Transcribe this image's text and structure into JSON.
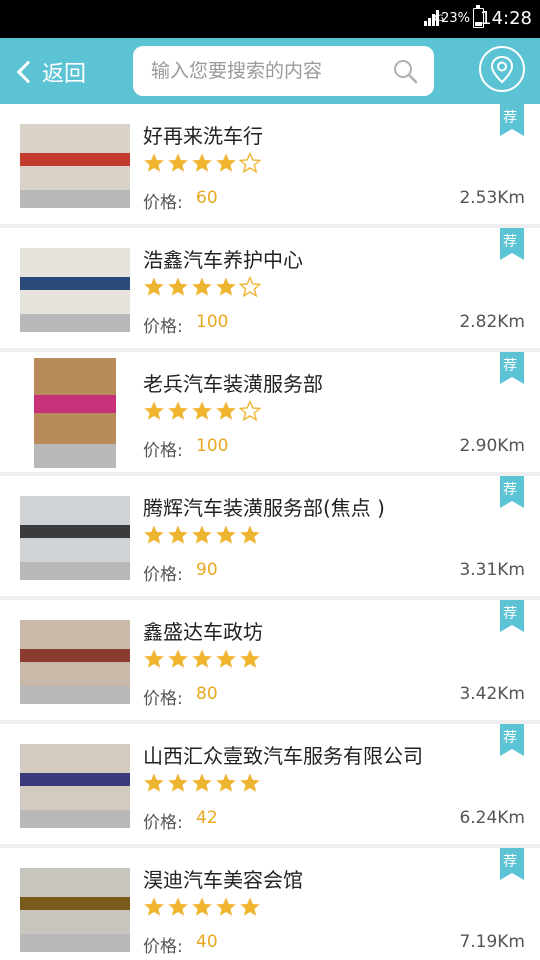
{
  "status_bar": {
    "network": "3G",
    "battery": "23%",
    "time": "14:28"
  },
  "header": {
    "back_label": "返回",
    "search_placeholder": "输入您要搜索的内容",
    "search_icon": "search-icon",
    "location_icon": "location-pin-icon"
  },
  "colors": {
    "accent": "#5cc3d4",
    "price": "#e8a820",
    "star": "#f0b530",
    "divider": "#eeeeee"
  },
  "price_label": "价格:",
  "badge_label": "荐",
  "items": [
    {
      "name": "好再来洗车行",
      "rating": 4,
      "price": "60",
      "distance": "2.53Km"
    },
    {
      "name": "浩鑫汽车养护中心",
      "rating": 4,
      "price": "100",
      "distance": "2.82Km"
    },
    {
      "name": "老兵汽车装潢服务部",
      "rating": 4,
      "price": "100",
      "distance": "2.90Km"
    },
    {
      "name": "腾辉汽车装潢服务部(焦点 )",
      "rating": 5,
      "price": "90",
      "distance": "3.31Km"
    },
    {
      "name": "鑫盛达车政坊",
      "rating": 5,
      "price": "80",
      "distance": "3.42Km"
    },
    {
      "name": "山西汇众壹致汽车服务有限公司",
      "rating": 5,
      "price": "42",
      "distance": "6.24Km"
    },
    {
      "name": "淏迪汽车美容会馆",
      "rating": 5,
      "price": "40",
      "distance": "7.19Km"
    }
  ]
}
